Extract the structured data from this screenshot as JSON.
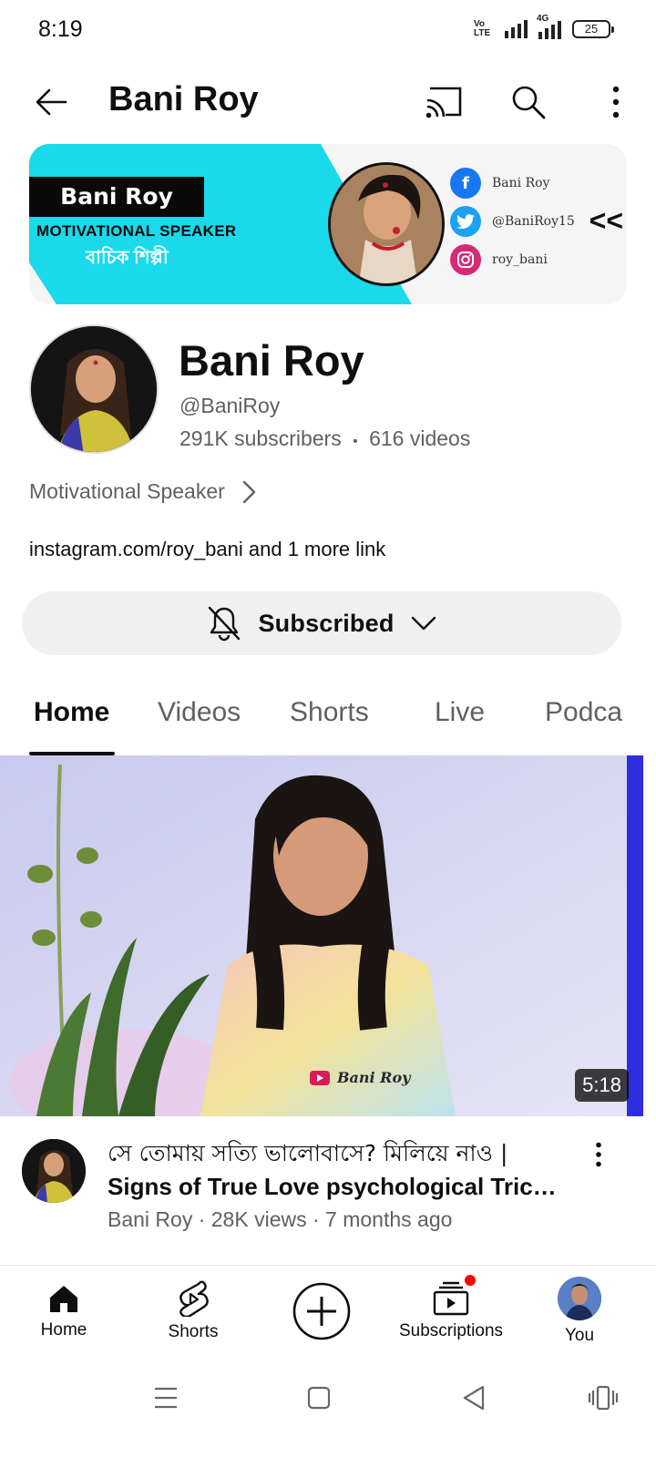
{
  "status_bar": {
    "time": "8:19",
    "volte": "Vo LTE",
    "network": "4G",
    "battery": "25"
  },
  "appbar": {
    "title": "Bani Roy"
  },
  "banner": {
    "name": "Bani Roy",
    "role": "MOTIVATIONAL SPEAKER",
    "role_bn": "বাচিক শিল্পী",
    "socials": [
      {
        "icon": "facebook-icon",
        "label": "Bani Roy",
        "color": "#1877f2"
      },
      {
        "icon": "twitter-icon",
        "label": "@BaniRoy15",
        "color": "#1da1f2"
      },
      {
        "icon": "instagram-icon",
        "label": "roy_bani",
        "color": "#d62976"
      }
    ],
    "arrow": "<<",
    "accent": "#1ad9ea"
  },
  "channel": {
    "name": "Bani Roy",
    "handle": "@BaniRoy",
    "subscribers": "291K subscribers",
    "videos": "616 videos",
    "stats_sep": "•",
    "about": "Motivational Speaker",
    "links": "instagram.com/roy_bani and 1 more link"
  },
  "subscribe": {
    "label": "Subscribed"
  },
  "tabs": [
    "Home",
    "Videos",
    "Shorts",
    "Live",
    "Podca"
  ],
  "video": {
    "duration": "5:18",
    "watermark": "Bani Roy",
    "title_line1": "সে তোমায় সত্যি ভালোবাসে?  মিলিয়ে নাও |",
    "title_line2": "Signs of True Love psychological Trick...",
    "meta": "Bani Roy · 28K views · 7 months ago"
  },
  "bottom_nav": {
    "items": [
      {
        "label": "Home",
        "icon": "home-icon"
      },
      {
        "label": "Shorts",
        "icon": "shorts-icon"
      },
      {
        "label": "",
        "icon": "create-icon"
      },
      {
        "label": "Subscriptions",
        "icon": "subscriptions-icon"
      },
      {
        "label": "You",
        "icon": "you-avatar"
      }
    ]
  }
}
